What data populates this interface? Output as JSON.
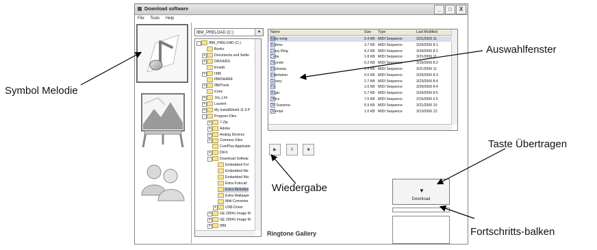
{
  "window": {
    "title": "Download software",
    "controls": [
      "_",
      "□",
      "X"
    ]
  },
  "menu": [
    "File",
    "Tools",
    "Help"
  ],
  "sidebar": {
    "items": [
      {
        "name": "melody",
        "icon": "music-note-icon",
        "selected": true
      },
      {
        "name": "wallpaper",
        "icon": "picture-frame-icon",
        "selected": false
      },
      {
        "name": "contacts",
        "icon": "people-icon",
        "selected": false
      }
    ]
  },
  "drive_select": {
    "value": "IBM_PRELOAD (C:)",
    "arrow": "▾"
  },
  "tree": {
    "items": [
      {
        "label": "IBM_PRELOAD (C:)",
        "level": 0,
        "pm": "-"
      },
      {
        "label": "Books",
        "level": 1,
        "pm": ""
      },
      {
        "label": "Documents and Settin",
        "level": 1,
        "pm": "+"
      },
      {
        "label": "DRIVERS",
        "level": 1,
        "pm": "+"
      },
      {
        "label": "Emails",
        "level": 1,
        "pm": ""
      },
      {
        "label": "I386",
        "level": 1,
        "pm": "+"
      },
      {
        "label": "IBMSHARE",
        "level": 1,
        "pm": ""
      },
      {
        "label": "IBMTools",
        "level": 1,
        "pm": "+"
      },
      {
        "label": "icons",
        "level": 1,
        "pm": ""
      },
      {
        "label": "Joy_Lim",
        "level": 1,
        "pm": "+"
      },
      {
        "label": "Laurent",
        "level": 1,
        "pm": "+"
      },
      {
        "label": "My InstallShield 11.5 P",
        "level": 1,
        "pm": "+"
      },
      {
        "label": "Program Files",
        "level": 1,
        "pm": "-"
      },
      {
        "label": "7-Zip",
        "level": 2,
        "pm": "+"
      },
      {
        "label": "Adobe",
        "level": 2,
        "pm": "+"
      },
      {
        "label": "Analog Devices",
        "level": 2,
        "pm": "+"
      },
      {
        "label": "Common Files",
        "level": 2,
        "pm": "+"
      },
      {
        "label": "ComPlus Applicatio",
        "level": 2,
        "pm": ""
      },
      {
        "label": "DIFX",
        "level": 2,
        "pm": "+"
      },
      {
        "label": "Download Softwar",
        "level": 2,
        "pm": "-"
      },
      {
        "label": "Embedded Fol",
        "level": 3,
        "pm": ""
      },
      {
        "label": "Embedded Me",
        "level": 3,
        "pm": ""
      },
      {
        "label": "Embedded Wa",
        "level": 3,
        "pm": ""
      },
      {
        "label": "Extra Fotocall",
        "level": 3,
        "pm": ""
      },
      {
        "label": "Extra Melodies",
        "level": 3,
        "pm": "",
        "selected": true
      },
      {
        "label": "Extra Wallpape",
        "level": 3,
        "pm": ""
      },
      {
        "label": "Midi Converter",
        "level": 3,
        "pm": ""
      },
      {
        "label": "USB Driver",
        "level": 3,
        "pm": "+"
      },
      {
        "label": "GE 28041 Image M",
        "level": 2,
        "pm": "+"
      },
      {
        "label": "GE 28041 Image M",
        "level": 2,
        "pm": "+"
      },
      {
        "label": "IBM",
        "level": 2,
        "pm": "+"
      }
    ]
  },
  "file_list": {
    "headers": [
      "Name",
      "Size",
      "Type",
      "Last Modified"
    ],
    "rows": [
      {
        "name": "Baby song",
        "size": "2.4 KB",
        "type": "MIDI Sequence",
        "modified": "3/21/2006 11",
        "selected": true
      },
      {
        "name": "Brahms",
        "size": "3.7 KB",
        "type": "MIDI Sequence",
        "modified": "3/29/2006 8:1"
      },
      {
        "name": "Crazy Ring",
        "size": "4.2 KB",
        "type": "MIDI Sequence",
        "modified": "3/29/2006 8:2"
      },
      {
        "name": "Cuba",
        "size": "1.8 KB",
        "type": "MIDI Sequence",
        "modified": "3/21/2006 11"
      },
      {
        "name": "Discrete",
        "size": "0.2 KB",
        "type": "MIDI Sequence",
        "modified": "3/29/2006 8:2"
      },
      {
        "name": "Electrasia",
        "size": "1.4 KB",
        "type": "MIDI Sequence",
        "modified": "3/21/2006 11"
      },
      {
        "name": "Entertainer",
        "size": "5.0 KB",
        "type": "MIDI Sequence",
        "modified": "3/29/2006 8:3"
      },
      {
        "name": "Groovy",
        "size": "2.7 KB",
        "type": "MIDI Sequence",
        "modified": "3/23/2006 8:4"
      },
      {
        "name": "Kid",
        "size": "1.6 KB",
        "type": "MIDI Sequence",
        "modified": "3/29/2006 8:4"
      },
      {
        "name": "Magic",
        "size": "5.7 KB",
        "type": "MIDI Sequence",
        "modified": "3/29/2006 8:5"
      },
      {
        "name": "Office",
        "size": "7.6 KB",
        "type": "MIDI Sequence",
        "modified": "2/15/2006 2:5"
      },
      {
        "name": "Oh Suzanna",
        "size": "5.9 KB",
        "type": "MIDI Sequence",
        "modified": "3/21/2006 10:"
      },
      {
        "name": "Oriental",
        "size": "1.0 KB",
        "type": "MIDI Sequence",
        "modified": "3/13/2006 12:"
      }
    ]
  },
  "player": {
    "play": "▶",
    "pause": "II",
    "stop": "■"
  },
  "gallery_label": "Ringtone Gallery",
  "download": {
    "label": "Download",
    "icon": "download-arrow-icon"
  },
  "annotations": {
    "symbol_melodie": "Symbol Melodie",
    "auswahlfenster": "Auswahlfenster",
    "wiedergabe": "Wiedergabe",
    "taste_uebertragen": "Taste Übertragen",
    "fortschritt": "Fortschritts-balken"
  }
}
